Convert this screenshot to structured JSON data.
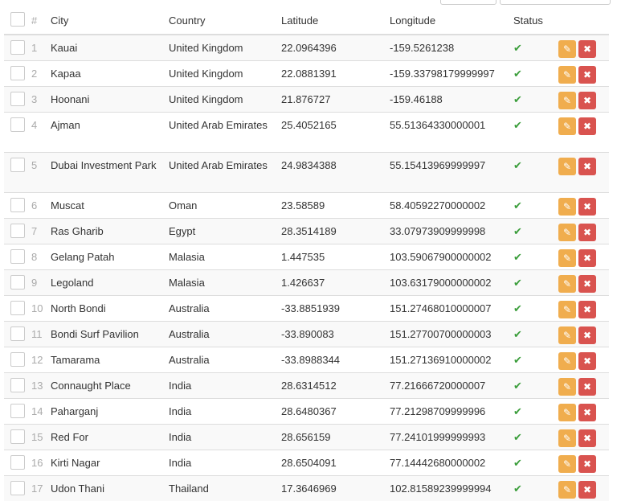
{
  "headers": {
    "index": "#",
    "city": "City",
    "country": "Country",
    "latitude": "Latitude",
    "longitude": "Longitude",
    "status": "Status"
  },
  "icons": {
    "status": "✔",
    "edit": "✎",
    "delete": "✖"
  },
  "rows": [
    {
      "index": "1",
      "city": "Kauai",
      "country": "United Kingdom",
      "latitude": "22.0964396",
      "longitude": "-159.5261238"
    },
    {
      "index": "2",
      "city": "Kapaa",
      "country": "United Kingdom",
      "latitude": "22.0881391",
      "longitude": "-159.33798179999997"
    },
    {
      "index": "3",
      "city": "Hoonani",
      "country": "United Kingdom",
      "latitude": "21.876727",
      "longitude": "-159.46188"
    },
    {
      "index": "4",
      "city": "Ajman",
      "country": "United Arab Emirates",
      "latitude": "25.4052165",
      "longitude": "55.51364330000001"
    },
    {
      "index": "5",
      "city": "Dubai Investment Park",
      "country": "United Arab Emirates",
      "latitude": "24.9834388",
      "longitude": "55.15413969999997"
    },
    {
      "index": "6",
      "city": "Muscat",
      "country": "Oman",
      "latitude": "23.58589",
      "longitude": "58.40592270000002"
    },
    {
      "index": "7",
      "city": "Ras Gharib",
      "country": "Egypt",
      "latitude": "28.3514189",
      "longitude": "33.07973909999998"
    },
    {
      "index": "8",
      "city": "Gelang Patah",
      "country": "Malasia",
      "latitude": "1.447535",
      "longitude": "103.59067900000002"
    },
    {
      "index": "9",
      "city": "Legoland",
      "country": "Malasia",
      "latitude": "1.426637",
      "longitude": "103.63179000000002"
    },
    {
      "index": "10",
      "city": "North Bondi",
      "country": "Australia",
      "latitude": "-33.8851939",
      "longitude": "151.27468010000007"
    },
    {
      "index": "11",
      "city": "Bondi Surf Pavilion",
      "country": "Australia",
      "latitude": "-33.890083",
      "longitude": "151.27700700000003"
    },
    {
      "index": "12",
      "city": "Tamarama",
      "country": "Australia",
      "latitude": "-33.8988344",
      "longitude": "151.27136910000002"
    },
    {
      "index": "13",
      "city": "Connaught Place",
      "country": "India",
      "latitude": "28.6314512",
      "longitude": "77.21666720000007"
    },
    {
      "index": "14",
      "city": "Paharganj",
      "country": "India",
      "latitude": "28.6480367",
      "longitude": "77.21298709999996"
    },
    {
      "index": "15",
      "city": "Red For",
      "country": "India",
      "latitude": "28.656159",
      "longitude": "77.24101999999993"
    },
    {
      "index": "16",
      "city": "Kirti Nagar",
      "country": "India",
      "latitude": "28.6504091",
      "longitude": "77.14442680000002"
    },
    {
      "index": "17",
      "city": "Udon Thani",
      "country": "Thailand",
      "latitude": "17.3646969",
      "longitude": "102.81589239999994"
    }
  ]
}
